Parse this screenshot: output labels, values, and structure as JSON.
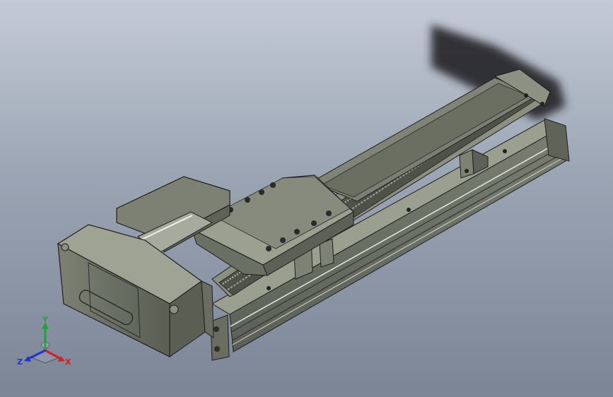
{
  "viewport": {
    "name": "3d-model-view",
    "background_top": "#c4cbd6",
    "background_bottom": "#7b8596",
    "model_body_color": "#6f7468",
    "model_edge_color": "#1e1e1e"
  },
  "triad": {
    "x_label": "X",
    "y_label": "Y",
    "z_label": "Z",
    "x_color": "#d32020",
    "y_color": "#21a33a",
    "z_color": "#2233cc"
  }
}
